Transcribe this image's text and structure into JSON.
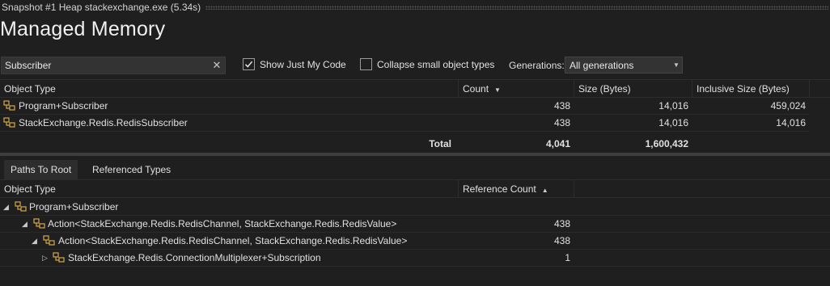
{
  "document": {
    "title": "Snapshot #1 Heap stackexchange.exe (5.34s)"
  },
  "page": {
    "title": "Managed Memory"
  },
  "filters": {
    "search_value": "Subscriber",
    "clear_glyph": "✕",
    "show_just_my_code": {
      "label": "Show Just My Code",
      "checked": true
    },
    "collapse_small": {
      "label": "Collapse small object types",
      "checked": false
    },
    "generations_label": "Generations:",
    "generations_value": "All generations"
  },
  "top_grid": {
    "columns": {
      "object_type": "Object Type",
      "count": "Count",
      "size": "Size (Bytes)",
      "inclusive": "Inclusive Size (Bytes)"
    },
    "count_sort": "▼",
    "rows": [
      {
        "name": "Program+Subscriber",
        "count": "438",
        "size": "14,016",
        "inclusive": "459,024"
      },
      {
        "name": "StackExchange.Redis.RedisSubscriber",
        "count": "438",
        "size": "14,016",
        "inclusive": "14,016"
      }
    ],
    "total": {
      "label": "Total",
      "count": "4,041",
      "size": "1,600,432"
    }
  },
  "bottom_tabs": {
    "paths_to_root": "Paths To Root",
    "referenced_types": "Referenced Types"
  },
  "bottom_grid": {
    "columns": {
      "object_type": "Object Type",
      "reference_count": "Reference Count"
    },
    "ref_sort": "▲",
    "rows": [
      {
        "name": "Program+Subscriber",
        "ref_count": "",
        "expander": "◢"
      },
      {
        "name": "Action<StackExchange.Redis.RedisChannel, StackExchange.Redis.RedisValue>",
        "ref_count": "438",
        "expander": "◢"
      },
      {
        "name": "Action<StackExchange.Redis.RedisChannel, StackExchange.Redis.RedisValue>",
        "ref_count": "438",
        "expander": "◢"
      },
      {
        "name": "StackExchange.Redis.ConnectionMultiplexer+Subscription",
        "ref_count": "1",
        "expander": "▷"
      }
    ]
  },
  "colors": {
    "background": "#1f1f1f",
    "icon_gold": "#d4a84a",
    "splitter": "#3e3e3e"
  },
  "icons": {
    "type_icon": "class-type-icon",
    "checkbox_check": "checkmark-icon"
  }
}
